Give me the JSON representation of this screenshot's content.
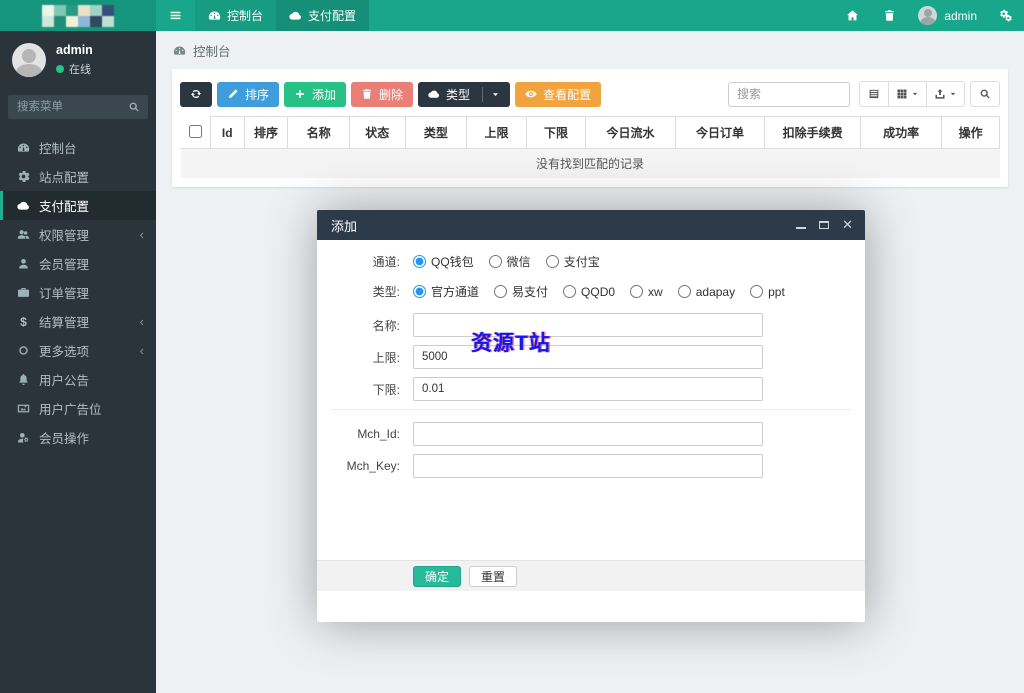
{
  "colors": {
    "navbar": "#19a78b",
    "brand": "#15967c",
    "sidebar": "#2a343a",
    "sidebar_active_border": "#1fae8e",
    "primary_btn": "#3f9ddb",
    "success_btn": "#28c185",
    "danger_btn": "#ea7f77",
    "warning_btn": "#f0a33f",
    "dark_btn": "#2c3640",
    "modal_header": "#2d3a4a",
    "ok_btn": "#26b99a",
    "online_dot": "#25c28b",
    "watermark_blue": "#1515f2"
  },
  "navbar": {
    "tabs": [
      {
        "label": "控制台",
        "icon": "dashboard-icon"
      },
      {
        "label": "支付配置",
        "icon": "cloud-icon",
        "active": true
      }
    ],
    "username": "admin"
  },
  "sidebar": {
    "user_name": "admin",
    "user_status": "在线",
    "search_placeholder": "搜索菜单",
    "items": [
      {
        "label": "控制台",
        "icon": "dashboard-icon"
      },
      {
        "label": "站点配置",
        "icon": "gear-icon"
      },
      {
        "label": "支付配置",
        "icon": "cloud-icon",
        "active": true
      },
      {
        "label": "权限管理",
        "icon": "users-icon",
        "has_submenu": true
      },
      {
        "label": "会员管理",
        "icon": "user-icon"
      },
      {
        "label": "订单管理",
        "icon": "briefcase-icon"
      },
      {
        "label": "结算管理",
        "icon": "dollar-icon",
        "has_submenu": true
      },
      {
        "label": "更多选项",
        "icon": "circle-icon",
        "has_submenu": true
      },
      {
        "label": "用户公告",
        "icon": "bell-icon"
      },
      {
        "label": "用户广告位",
        "icon": "image-icon"
      },
      {
        "label": "会员操作",
        "icon": "user-cog-icon"
      }
    ]
  },
  "breadcrumb": {
    "label": "控制台"
  },
  "toolbar": {
    "sort_label": "排序",
    "add_label": "添加",
    "delete_label": "删除",
    "type_label": "类型",
    "view_config_label": "查看配置",
    "search_placeholder": "搜索"
  },
  "table": {
    "headers": [
      "Id",
      "排序",
      "名称",
      "状态",
      "类型",
      "上限",
      "下限",
      "今日流水",
      "今日订单",
      "扣除手续费",
      "成功率",
      "操作"
    ],
    "empty_text": "没有找到匹配的记录"
  },
  "modal": {
    "title": "添加",
    "channel_label": "通道:",
    "channel_options": [
      {
        "label": "QQ钱包",
        "checked": true
      },
      {
        "label": "微信"
      },
      {
        "label": "支付宝"
      }
    ],
    "type_label": "类型:",
    "type_options": [
      {
        "label": "官方通道",
        "checked": true
      },
      {
        "label": "易支付"
      },
      {
        "label": "QQD0"
      },
      {
        "label": "xw"
      },
      {
        "label": "adapay"
      },
      {
        "label": "ppt"
      }
    ],
    "name_label": "名称:",
    "name_value": "",
    "upper_label": "上限:",
    "upper_value": "5000",
    "lower_label": "下限:",
    "lower_value": "0.01",
    "mch_id_label": "Mch_Id:",
    "mch_id_value": "",
    "mch_key_label": "Mch_Key:",
    "mch_key_value": "",
    "ok_label": "确定",
    "reset_label": "重置"
  },
  "watermark": "资源T站"
}
